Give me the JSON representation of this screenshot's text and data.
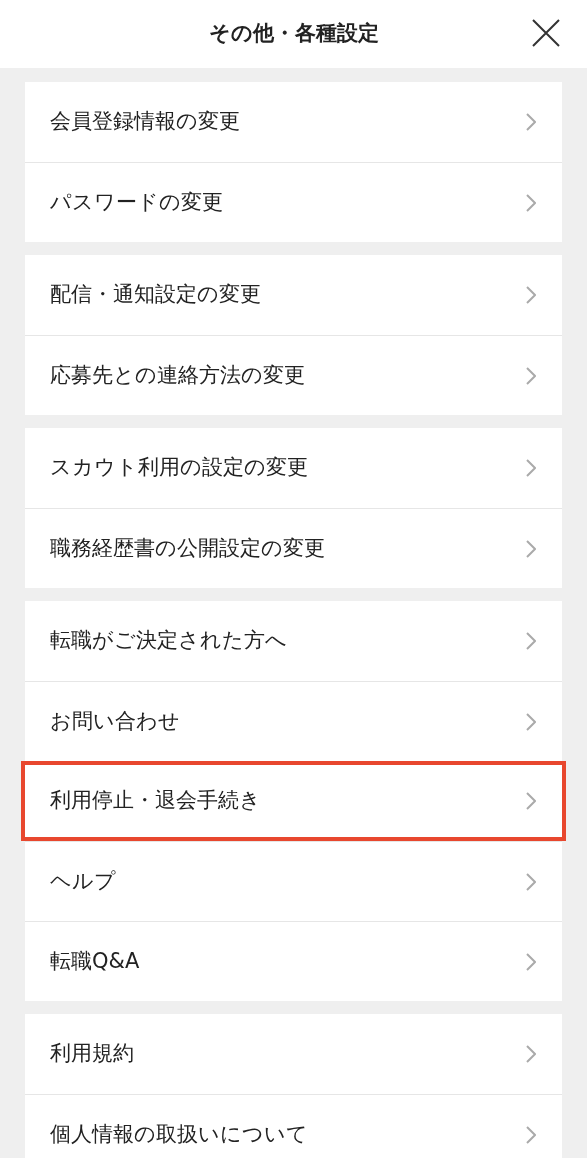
{
  "header": {
    "title": "その他・各種設定"
  },
  "groups": [
    {
      "items": [
        {
          "label": "会員登録情報の変更",
          "highlighted": false
        },
        {
          "label": "パスワードの変更",
          "highlighted": false
        }
      ]
    },
    {
      "items": [
        {
          "label": "配信・通知設定の変更",
          "highlighted": false
        },
        {
          "label": "応募先との連絡方法の変更",
          "highlighted": false
        }
      ]
    },
    {
      "items": [
        {
          "label": "スカウト利用の設定の変更",
          "highlighted": false
        },
        {
          "label": "職務経歴書の公開設定の変更",
          "highlighted": false
        }
      ]
    },
    {
      "items": [
        {
          "label": "転職がご決定された方へ",
          "highlighted": false
        },
        {
          "label": "お問い合わせ",
          "highlighted": false
        },
        {
          "label": "利用停止・退会手続き",
          "highlighted": true
        },
        {
          "label": "ヘルプ",
          "highlighted": false
        },
        {
          "label": "転職Q&A",
          "highlighted": false
        }
      ]
    },
    {
      "items": [
        {
          "label": "利用規約",
          "highlighted": false
        },
        {
          "label": "個人情報の取扱いについて",
          "highlighted": false
        }
      ]
    }
  ]
}
